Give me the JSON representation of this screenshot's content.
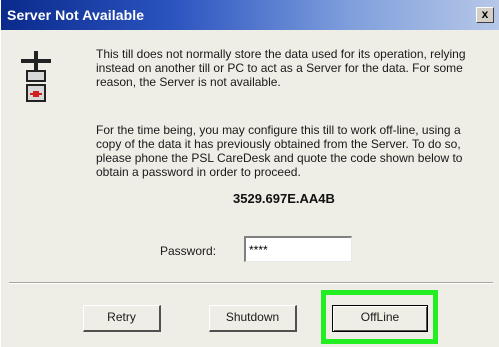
{
  "dialog": {
    "title": "Server Not Available",
    "close_label": "x",
    "message_1": "This till does not normally store the data used for its operation, relying instead on another till or PC to act as a Server for the data. For some reason, the Server is not available.",
    "message_2": "For the time being, you may configure this till to work off-line, using a copy of the data it has previously obtained from the Server. To do so, please phone the PSL CareDesk and quote the code shown below to obtain a password in order to proceed.",
    "code": "3529.697E.AA4B",
    "password_label": "Password:",
    "password_value": "****"
  },
  "buttons": {
    "retry": "Retry",
    "shutdown": "Shutdown",
    "offline": "OffLine"
  },
  "highlight": {
    "target": "offline-button",
    "color": "#22ee22"
  },
  "colors": {
    "title_bar": "#0a2a8c",
    "dialog_background": "#eeede6"
  },
  "icons": {
    "server": "server-icon",
    "close": "close-icon"
  }
}
